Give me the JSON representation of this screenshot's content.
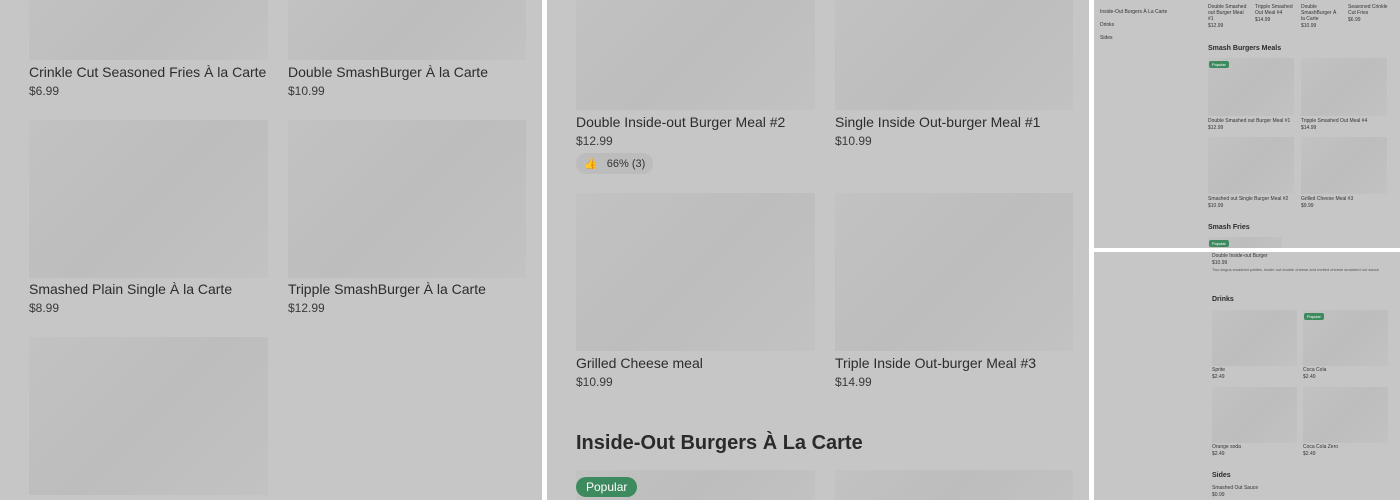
{
  "panel1": {
    "items": [
      {
        "name": "Crinkle Cut Seasoned Fries À la Carte",
        "price": "$6.99"
      },
      {
        "name": "Double SmashBurger À la Carte",
        "price": "$10.99"
      },
      {
        "name": "Smashed Plain Single À la Carte",
        "price": "$8.99"
      },
      {
        "name": "Tripple SmashBurger À la Carte",
        "price": "$12.99"
      }
    ]
  },
  "panel2": {
    "items": [
      {
        "name": "Double Inside-out Burger Meal #2",
        "price": "$12.99",
        "rating": "66% (3)"
      },
      {
        "name": "Single Inside Out-burger Meal #1",
        "price": "$10.99"
      },
      {
        "name": "Grilled Cheese meal",
        "price": "$10.99"
      },
      {
        "name": "Triple Inside Out-burger Meal #3",
        "price": "$14.99"
      }
    ],
    "section_title": "Inside-Out Burgers À La Carte",
    "badge": "Popular"
  },
  "panel3": {
    "sidebar": [
      "Inside-Out Burgers À La Carte",
      "Drinks",
      "Sides"
    ],
    "top_items": [
      {
        "name": "Double Smashed out Burger Meal #1",
        "price": "$12.99"
      },
      {
        "name": "Tripple Smashed Out Meal #4",
        "price": "$14.99"
      },
      {
        "name": "Double SmashBurger À la Carte",
        "price": "$10.99"
      },
      {
        "name": "Seasoned Crinkle Cut Fries",
        "price": "$6.99"
      }
    ],
    "section_title": "Smash Burgers Meals",
    "badge": "Popular",
    "items": [
      {
        "name": "Double Smashed out Burger Meal #1",
        "price": "$12.99"
      },
      {
        "name": "Tripple Smashed Out Meal #4",
        "price": "$14.99"
      },
      {
        "name": "Smashed out Single Burger Meal #2",
        "price": "$10.99"
      },
      {
        "name": "Grilled Cheese Meal #3",
        "price": "$9.99"
      }
    ],
    "section2_title": "Smash Fries"
  },
  "panel4": {
    "item_name": "Double Inside-out Burger",
    "item_price": "$10.99",
    "item_desc": "Two Angus smashed patties, inside out double cheese and melted cheese smashed out sauce",
    "drinks_title": "Drinks",
    "badge": "Popular",
    "drinks": [
      {
        "name": "Sprite",
        "price": "$2.49"
      },
      {
        "name": "Coca Cola",
        "price": "$2.49"
      },
      {
        "name": "Orange soda",
        "price": "$2.49"
      },
      {
        "name": "Coca Cola Zero",
        "price": "$2.49"
      }
    ],
    "sides_title": "Sides",
    "sides": [
      {
        "name": "Smashed Out Sauce",
        "price": "$0.99"
      }
    ]
  }
}
